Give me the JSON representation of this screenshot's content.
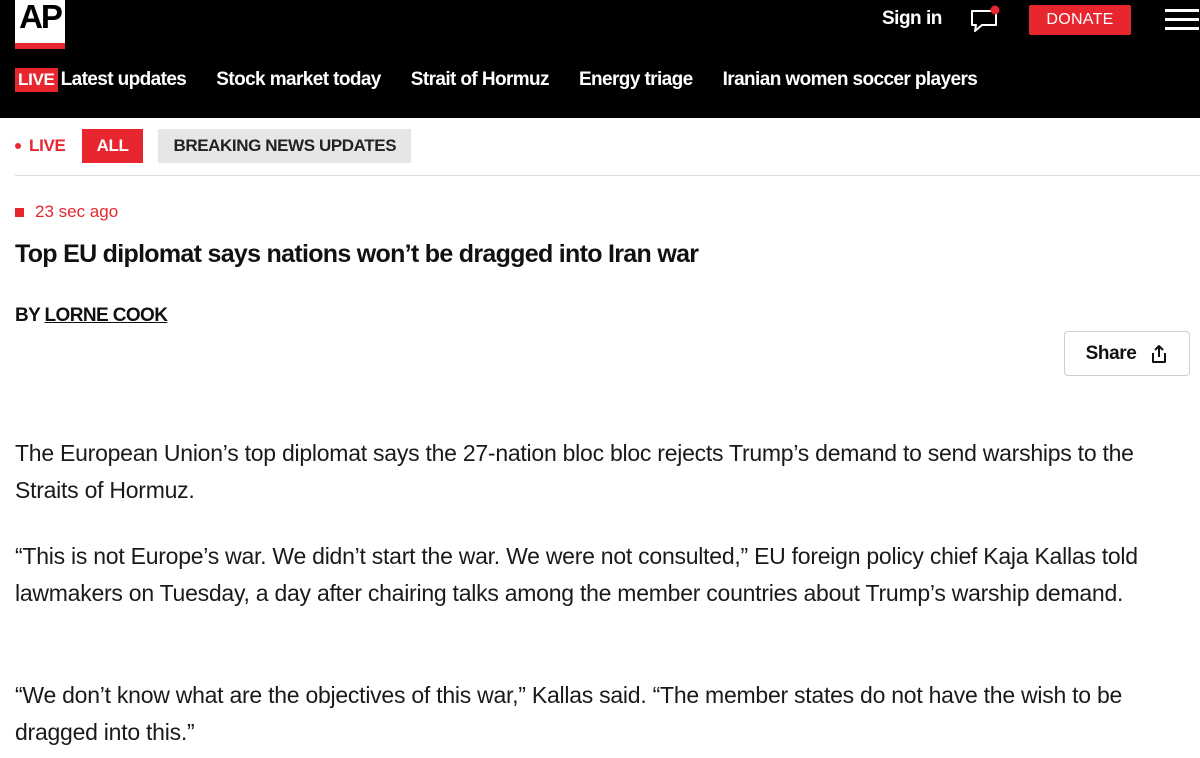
{
  "header": {
    "logo_text": "AP",
    "signin_label": "Sign in",
    "donate_label": "DONATE",
    "colors": {
      "background": "#000000",
      "accent": "#e8262f"
    }
  },
  "nav": {
    "live_badge": "LIVE",
    "items": [
      {
        "label": "Latest updates"
      },
      {
        "label": "Stock market today"
      },
      {
        "label": "Strait of Hormuz"
      },
      {
        "label": "Energy triage"
      },
      {
        "label": "Iranian women soccer players"
      }
    ]
  },
  "filters": {
    "live_label": "LIVE",
    "all_label": "ALL",
    "breaking_label": "BREAKING NEWS UPDATES"
  },
  "post": {
    "timestamp": "23 sec ago",
    "headline": "Top EU diplomat says nations won’t be dragged into Iran war",
    "byline_prefix": "BY",
    "author": "LORNE COOK",
    "share_label": "Share",
    "paragraphs": [
      "The European Union’s top diplomat says the 27-nation bloc bloc rejects Trump’s demand to send warships to the Straits of Hormuz.",
      "“This is not Europe’s war. We didn’t start the war. We were not consulted,” EU foreign policy chief Kaja Kallas told lawmakers on Tuesday, a day after chairing talks among the member countries about Trump’s warship demand.",
      "“We don’t know what are the objectives of this war,” Kallas said. “The member states do not have the wish to be dragged into this.”"
    ]
  },
  "icons": {
    "chat": "chat-bubble-icon",
    "menu": "hamburger-menu-icon",
    "share": "share-icon"
  }
}
